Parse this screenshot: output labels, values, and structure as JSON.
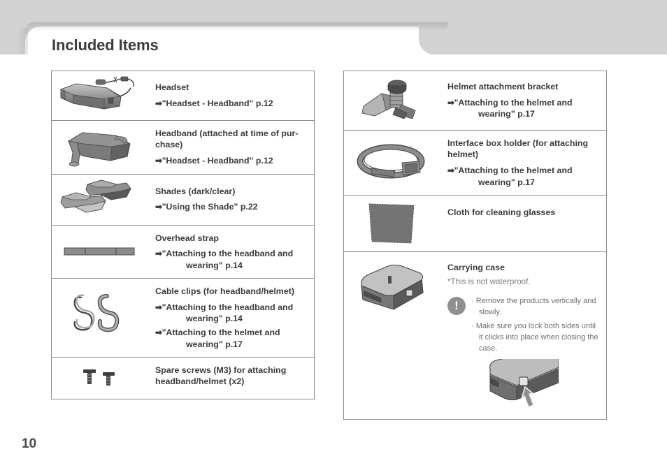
{
  "page": {
    "title": "Included Items",
    "number": "10"
  },
  "icons": {
    "arrow": "➡",
    "caution": "!",
    "bullet": "·"
  },
  "left_table": [
    {
      "image": "headset-glasses-image",
      "name": "Headset",
      "refs": [
        {
          "arrow": "➡",
          "text": "\"Headset - Headband\" p.12",
          "cont": ""
        }
      ]
    },
    {
      "image": "headband-image",
      "name": "Headband (attached at time of pur-chase)",
      "name_line1": "Headband (attached at time of pur-",
      "name_line2": "chase)",
      "refs": [
        {
          "arrow": "➡",
          "text": "\"Headset - Headband\" p.12",
          "cont": ""
        }
      ]
    },
    {
      "image": "shades-image",
      "name": "Shades (dark/clear)",
      "refs": [
        {
          "arrow": "➡",
          "text": "\"Using the Shade\" p.22",
          "cont": ""
        }
      ]
    },
    {
      "image": "overhead-strap-image",
      "name": "Overhead strap",
      "refs": [
        {
          "arrow": "➡",
          "text": "\"Attaching to the headband and",
          "cont": "wearing\" p.14"
        }
      ]
    },
    {
      "image": "cable-clips-image",
      "name": "Cable clips (for headband/helmet)",
      "refs": [
        {
          "arrow": "➡",
          "text": "\"Attaching to the headband and",
          "cont": "wearing\" p.14"
        },
        {
          "arrow": "➡",
          "text": "\"Attaching to the helmet and",
          "cont": "wearing\" p.17"
        }
      ]
    },
    {
      "image": "spare-screws-image",
      "name": "Spare screws (M3) for attaching headband/helmet (x2)",
      "name_line1": "Spare screws (M3) for attaching",
      "name_line2": "headband/helmet (x2)",
      "refs": []
    }
  ],
  "right_table": [
    {
      "image": "helmet-bracket-image",
      "name": "Helmet attachment bracket",
      "refs": [
        {
          "arrow": "➡",
          "text": "\"Attaching to the helmet and",
          "cont": "wearing\" p.17"
        }
      ]
    },
    {
      "image": "interface-box-holder-image",
      "name": "Interface box holder (for attaching helmet)",
      "name_line1": "Interface box holder (for attaching",
      "name_line2": "helmet)",
      "refs": [
        {
          "arrow": "➡",
          "text": "\"Attaching to the helmet and",
          "cont": "wearing\" p.17"
        }
      ]
    },
    {
      "image": "cleaning-cloth-image",
      "name": "Cloth for cleaning glasses",
      "refs": []
    }
  ],
  "carrying_case": {
    "image": "carrying-case-image",
    "name": "Carrying case",
    "note": "*This is not waterproof.",
    "caution_items": [
      "Remove the products vertically and slowly.",
      "Make sure you lock both sides until it clicks into place when closing the case."
    ],
    "figure": "case-latch-closeup-image"
  },
  "colors": {
    "chrome_gray": "#d2d2d2",
    "border": "#8a8a8a",
    "text": "#3b3b3b",
    "muted_text": "#7b7b7b",
    "caution_icon": "#8f8f8f",
    "product_dark": "#5e5e5e",
    "product_light": "#b9b9b9"
  }
}
